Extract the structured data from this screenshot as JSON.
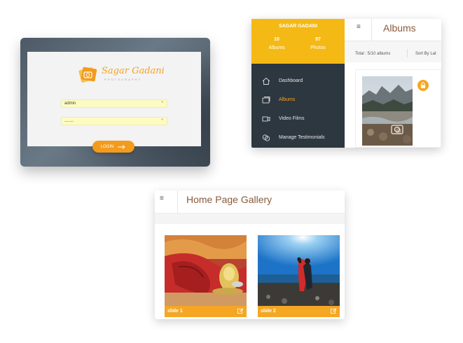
{
  "login": {
    "brand": "Sagar Gadani",
    "brand_sub": "PHOTOGRAPHY",
    "username_value": "admin",
    "password_value": "........",
    "required_mark": "*",
    "login_label": "LOGIN"
  },
  "albums_panel": {
    "user_name": "SAGAR GADANI",
    "stats": [
      {
        "value": "10",
        "label": "Albums"
      },
      {
        "value": "97",
        "label": "Photos"
      }
    ],
    "nav": [
      {
        "label": "Dashboard",
        "icon": "home-icon",
        "active": false
      },
      {
        "label": "Albums",
        "icon": "albums-icon",
        "active": true
      },
      {
        "label": "Video Films",
        "icon": "video-icon",
        "active": false
      },
      {
        "label": "Manage Testimonials",
        "icon": "testimonials-icon",
        "active": false
      }
    ],
    "menu_icon": "≡",
    "title": "Albums",
    "total_text": "Total : 5/10 albums",
    "sort_text": "Sort By Lat",
    "lock_icon": "lock-icon"
  },
  "gallery": {
    "menu_icon": "≡",
    "title": "Home Page Gallery",
    "slides": [
      {
        "caption": "slide 1"
      },
      {
        "caption": "slide 2"
      }
    ]
  },
  "colors": {
    "accent": "#f5a623",
    "sidebar_bg": "#2d3740",
    "sidebar_head": "#f5b915",
    "title_brown": "#8a5a3c",
    "input_yellow": "#fbfbc2"
  }
}
